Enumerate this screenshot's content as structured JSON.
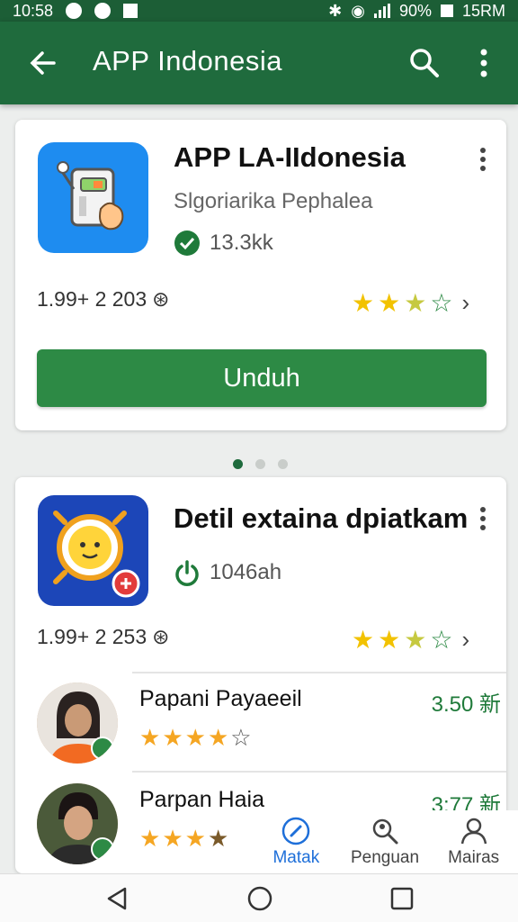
{
  "status": {
    "time": "10:58",
    "battery": "90%",
    "extra": "15RM"
  },
  "appbar": {
    "title": "APP Indonesia"
  },
  "card1": {
    "name": "APP LA-IIdonesia",
    "developer": "Slgoriarika Pephalea",
    "verified_count": "13.3kk",
    "price": "1.99+ 2 203",
    "rating": 3.5,
    "install_label": "Unduh"
  },
  "card2": {
    "name": "Detil extaina dpiatkam",
    "power_meta": "1046ah",
    "price": "1.99+ 2 253",
    "rating": 3.5
  },
  "reviews": [
    {
      "name": "Papani Payaeeil",
      "score": "3.50 新",
      "rating": 4.5
    },
    {
      "name": "Parpan Haia",
      "score": "3:77 新",
      "rating": 3.5
    }
  ],
  "tabs": [
    {
      "label": "Matak",
      "icon": "compass-icon",
      "active": true
    },
    {
      "label": "Penguan",
      "icon": "search-people-icon",
      "active": false
    },
    {
      "label": "Mairas",
      "icon": "person-icon",
      "active": false
    }
  ],
  "colors": {
    "primary": "#1f6b3d",
    "button": "#2d8a45",
    "star": "#f2c200",
    "accent_blue": "#1e6fd9"
  }
}
